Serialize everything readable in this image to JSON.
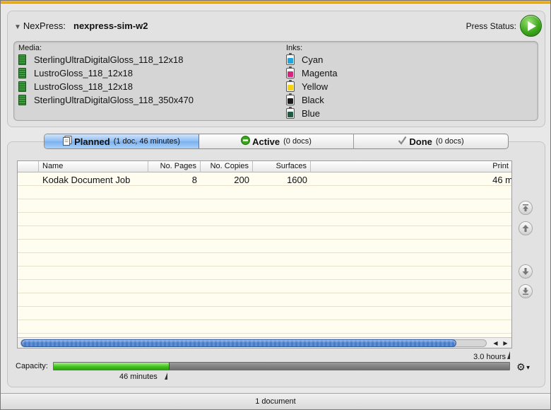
{
  "header": {
    "product_label": "NexPress:",
    "press_name": "nexpress-sim-w2",
    "press_status_label": "Press Status:"
  },
  "media": {
    "title": "Media:",
    "items": [
      "SterlingUltraDigitalGloss_118_12x18",
      "LustroGloss_118_12x18",
      "LustroGloss_118_12x18",
      "SterlingUltraDigitalGloss_118_350x470"
    ]
  },
  "inks": {
    "title": "Inks:",
    "items": [
      {
        "name": "Cyan",
        "color": "#1fa4dc"
      },
      {
        "name": "Magenta",
        "color": "#d6237c"
      },
      {
        "name": "Yellow",
        "color": "#f5d214"
      },
      {
        "name": "Black",
        "color": "#1a1a1a"
      },
      {
        "name": "Blue",
        "color": "#1f5a42"
      }
    ]
  },
  "tabs": [
    {
      "title": "Planned",
      "detail": "(1 doc, 46 minutes)",
      "icon": "document-icon",
      "selected": true
    },
    {
      "title": "Active",
      "detail": "(0 docs)",
      "icon": "active-status-icon",
      "selected": false
    },
    {
      "title": "Done",
      "detail": "(0 docs)",
      "icon": "checkmark-icon",
      "selected": false
    }
  ],
  "table": {
    "columns": [
      "Name",
      "No. Pages",
      "No. Copies",
      "Surfaces",
      "Print I"
    ],
    "rows": [
      {
        "name": "Kodak Document Job",
        "pages": "8",
        "copies": "200",
        "surfaces": "1600",
        "print": "46 m"
      }
    ]
  },
  "capacity": {
    "label": "Capacity:",
    "max_label": "3.0 hours",
    "used_label": "46 minutes",
    "fraction": 0.255
  },
  "status_bar": {
    "text": "1 document"
  }
}
